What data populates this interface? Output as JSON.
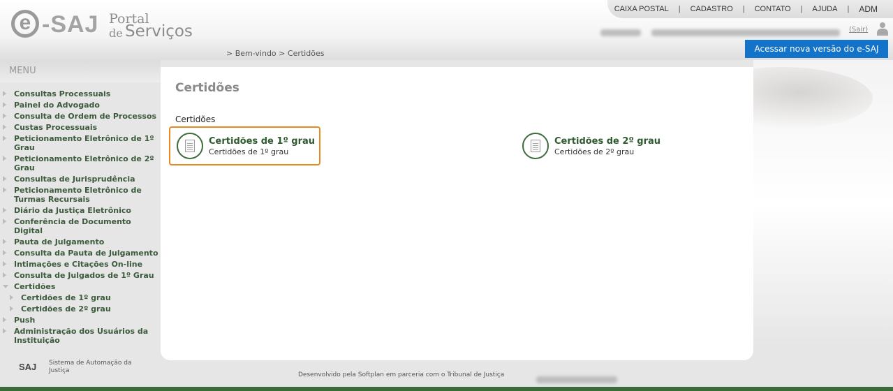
{
  "header": {
    "logo_e": "e",
    "logo_saj": "-SAJ",
    "logo_portal": "Portal",
    "logo_de": "de",
    "logo_servicos": "Serviços",
    "nav": [
      "CAIXA POSTAL",
      "CADASTRO",
      "CONTATO",
      "AJUDA",
      "ADM"
    ],
    "sair": "(Sair)",
    "new_version_button": "Acessar nova versão do e-SAJ"
  },
  "breadcrumb": {
    "home": "> Bem-vindo",
    "current": "> Certidões"
  },
  "sidebar": {
    "title": "MENU",
    "items": [
      {
        "label": "Consultas Processuais",
        "level": 0,
        "expanded": false
      },
      {
        "label": "Painel do Advogado",
        "level": 0,
        "expanded": false
      },
      {
        "label": "Consulta de Ordem de Processos",
        "level": 0,
        "expanded": false
      },
      {
        "label": "Custas Processuais",
        "level": 0,
        "expanded": false
      },
      {
        "label": "Peticionamento Eletrônico de 1º Grau",
        "level": 0,
        "expanded": false
      },
      {
        "label": "Peticionamento Eletrônico de 2º Grau",
        "level": 0,
        "expanded": false
      },
      {
        "label": "Consultas de Jurisprudência",
        "level": 0,
        "expanded": false
      },
      {
        "label": "Peticionamento Eletrônico de Turmas Recursais",
        "level": 0,
        "expanded": false
      },
      {
        "label": "Diário da Justiça Eletrônico",
        "level": 0,
        "expanded": false
      },
      {
        "label": "Conferência de Documento Digital",
        "level": 0,
        "expanded": false
      },
      {
        "label": "Pauta de Julgamento",
        "level": 0,
        "expanded": false
      },
      {
        "label": "Consulta da Pauta de Julgamento",
        "level": 0,
        "expanded": false
      },
      {
        "label": "Intimações e Citações On-line",
        "level": 0,
        "expanded": false
      },
      {
        "label": "Consulta de Julgados de 1º Grau",
        "level": 0,
        "expanded": false
      },
      {
        "label": "Certidões",
        "level": 0,
        "expanded": true
      },
      {
        "label": "Certidões de 1º grau",
        "level": 1,
        "expanded": false
      },
      {
        "label": "Certidões de 2º grau",
        "level": 1,
        "expanded": false
      },
      {
        "label": "Push",
        "level": 0,
        "expanded": false
      },
      {
        "label": "Administração dos Usuários da Instituição",
        "level": 0,
        "expanded": false
      }
    ]
  },
  "main": {
    "title": "Certidões",
    "section": "Certidões",
    "cards": [
      {
        "title": "Certidões de 1º grau",
        "subtitle": "Certidões de 1º grau",
        "selected": true
      },
      {
        "title": "Certidões de 2º grau",
        "subtitle": "Certidões de 2º grau",
        "selected": false
      }
    ]
  },
  "footer": {
    "logo": "SAJ",
    "system": "Sistema de Automação da Justiça",
    "developed_by": "Desenvolvido pela Softplan em parceria com o Tribunal de Justiça"
  },
  "colors": {
    "accent_blue": "#1273c9",
    "menu_green": "#3c5a3c",
    "card_green": "#2f5a2f",
    "selected_border": "#e8891e",
    "bottom_bar": "#3b6b3b"
  }
}
